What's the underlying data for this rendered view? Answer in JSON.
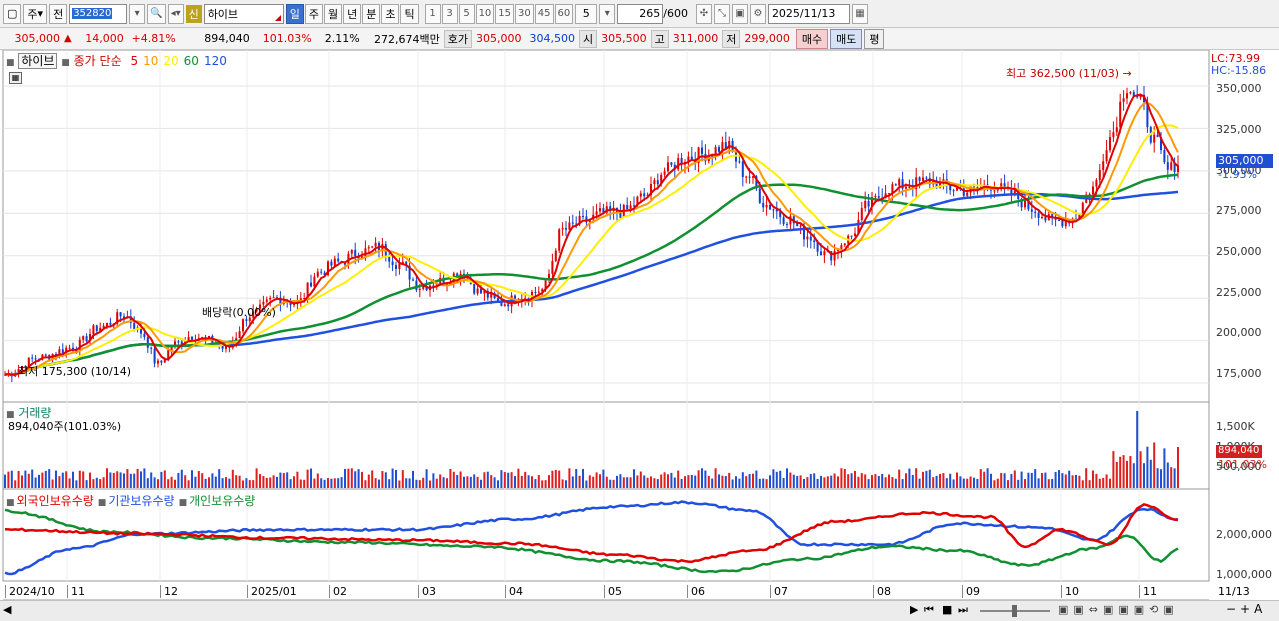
{
  "toolbar": {
    "period_main": "주",
    "prev_label": "전",
    "stock_code": "352820",
    "new_badge": "신",
    "stock_name": "하이브",
    "periods": [
      "일",
      "주",
      "월",
      "년",
      "분",
      "초",
      "틱"
    ],
    "selected_period": "일",
    "minute_intervals": [
      "1",
      "3",
      "5",
      "10",
      "15",
      "30",
      "45",
      "60"
    ],
    "custom_interval": "5",
    "count": "265",
    "count_max": "/600",
    "date": "2025/11/13"
  },
  "quote": {
    "price": "305,000",
    "change": "14,000",
    "change_pct": "+4.81%",
    "volume": "894,040",
    "volume_ratio": "101.03%",
    "turnover": "2.11%",
    "amount": "272,674백만",
    "ask_label": "호가",
    "ask1": "305,000",
    "ask2": "304,500",
    "open_label": "시",
    "open": "305,500",
    "high_label": "고",
    "high": "311,000",
    "low_label": "저",
    "low": "299,000",
    "buy_label": "매수",
    "sell_label": "매도",
    "avg_label": "평"
  },
  "price_panel": {
    "stock_label": "하이브",
    "ma_title": "종가 단순",
    "ma_periods": [
      "5",
      "10",
      "20",
      "60",
      "120"
    ],
    "ma_colors": [
      "#e00000",
      "#ff9900",
      "#ffee00",
      "#109030",
      "#2050e0"
    ],
    "lc_label": "LC:73.99",
    "hc_label": "HC:-15.86",
    "high_annotation": "최고 362,500 (11/03)",
    "low_annotation": "최저 175,300 (10/14)",
    "dividend_annotation": "배당락(0.00%)",
    "current_price_tag": "305,000",
    "current_change_tag": "-1.93%",
    "y_ticks": [
      "350,000",
      "325,000",
      "300,000",
      "275,000",
      "250,000",
      "225,000",
      "200,000",
      "175,000"
    ]
  },
  "volume_panel": {
    "title": "거래량",
    "current": "894,040주(101.03%)",
    "y_ticks": [
      "1,500K",
      "1,000K",
      "500,000"
    ],
    "tag_value": "894,040",
    "tag_pct": "101.03%"
  },
  "holding_panel": {
    "series": [
      "외국인보유수량",
      "기관보유수량",
      "개인보유수량"
    ],
    "colors": [
      "#e00000",
      "#2050e0",
      "#109030"
    ],
    "y_ticks": [
      "2,000,000",
      "1,000,000"
    ]
  },
  "x_axis": {
    "labels": [
      "2024/10",
      "11",
      "12",
      "2025/01",
      "02",
      "03",
      "04",
      "05",
      "06",
      "07",
      "08",
      "09",
      "10",
      "11"
    ],
    "current_date": "11/13"
  },
  "chart_data": {
    "type": "line",
    "title": "하이브",
    "price_range": [
      165000,
      370000
    ],
    "price_anchors": [
      [
        0,
        180000
      ],
      [
        10,
        190000
      ],
      [
        20,
        196000
      ],
      [
        28,
        208000
      ],
      [
        35,
        215000
      ],
      [
        40,
        205000
      ],
      [
        45,
        186000
      ],
      [
        50,
        198000
      ],
      [
        55,
        203000
      ],
      [
        60,
        200000
      ],
      [
        65,
        195000
      ],
      [
        72,
        215000
      ],
      [
        80,
        225000
      ],
      [
        86,
        222000
      ],
      [
        92,
        240000
      ],
      [
        98,
        246000
      ],
      [
        104,
        252000
      ],
      [
        110,
        255000
      ],
      [
        116,
        245000
      ],
      [
        122,
        232000
      ],
      [
        128,
        235000
      ],
      [
        134,
        240000
      ],
      [
        140,
        228000
      ],
      [
        146,
        222000
      ],
      [
        152,
        226000
      ],
      [
        158,
        230000
      ],
      [
        164,
        265000
      ],
      [
        170,
        270000
      ],
      [
        176,
        275000
      ],
      [
        182,
        276000
      ],
      [
        188,
        285000
      ],
      [
        194,
        300000
      ],
      [
        200,
        308000
      ],
      [
        206,
        310000
      ],
      [
        212,
        315000
      ],
      [
        218,
        298000
      ],
      [
        224,
        280000
      ],
      [
        230,
        272000
      ],
      [
        236,
        262000
      ],
      [
        242,
        250000
      ],
      [
        248,
        260000
      ],
      [
        254,
        280000
      ],
      [
        260,
        290000
      ],
      [
        266,
        292000
      ],
      [
        272,
        294000
      ],
      [
        278,
        290000
      ],
      [
        284,
        288000
      ],
      [
        290,
        292000
      ],
      [
        296,
        286000
      ],
      [
        302,
        278000
      ],
      [
        308,
        270000
      ],
      [
        314,
        272000
      ],
      [
        320,
        290000
      ],
      [
        325,
        320000
      ],
      [
        330,
        350000
      ],
      [
        334,
        340000
      ],
      [
        338,
        318000
      ],
      [
        342,
        300000
      ],
      [
        345,
        305000
      ]
    ],
    "foreign_anchors": [
      [
        0,
        2.05
      ],
      [
        40,
        1.95
      ],
      [
        80,
        1.85
      ],
      [
        120,
        1.8
      ],
      [
        150,
        1.72
      ],
      [
        180,
        1.45
      ],
      [
        200,
        1.3
      ],
      [
        220,
        1.55
      ],
      [
        245,
        2.25
      ],
      [
        270,
        2.45
      ],
      [
        290,
        2.35
      ],
      [
        300,
        1.65
      ],
      [
        310,
        2.05
      ],
      [
        325,
        1.7
      ],
      [
        335,
        2.65
      ],
      [
        345,
        2.3
      ]
    ],
    "institution_anchors": [
      [
        0,
        1.0
      ],
      [
        20,
        1.6
      ],
      [
        40,
        1.95
      ],
      [
        80,
        2.05
      ],
      [
        120,
        2.05
      ],
      [
        150,
        2.3
      ],
      [
        180,
        2.6
      ],
      [
        200,
        2.7
      ],
      [
        220,
        2.5
      ],
      [
        235,
        1.7
      ],
      [
        260,
        1.7
      ],
      [
        280,
        2.2
      ],
      [
        305,
        2.1
      ],
      [
        320,
        1.8
      ],
      [
        335,
        2.55
      ],
      [
        345,
        2.3
      ]
    ],
    "individual_anchors": [
      [
        0,
        2.5
      ],
      [
        30,
        2.0
      ],
      [
        60,
        1.85
      ],
      [
        100,
        1.75
      ],
      [
        140,
        1.65
      ],
      [
        180,
        1.3
      ],
      [
        210,
        1.05
      ],
      [
        235,
        1.35
      ],
      [
        260,
        1.65
      ],
      [
        280,
        1.55
      ],
      [
        300,
        1.2
      ],
      [
        320,
        1.6
      ],
      [
        330,
        1.9
      ],
      [
        340,
        1.3
      ],
      [
        345,
        1.6
      ]
    ],
    "volume_max": 1650000,
    "x_count": 346
  }
}
